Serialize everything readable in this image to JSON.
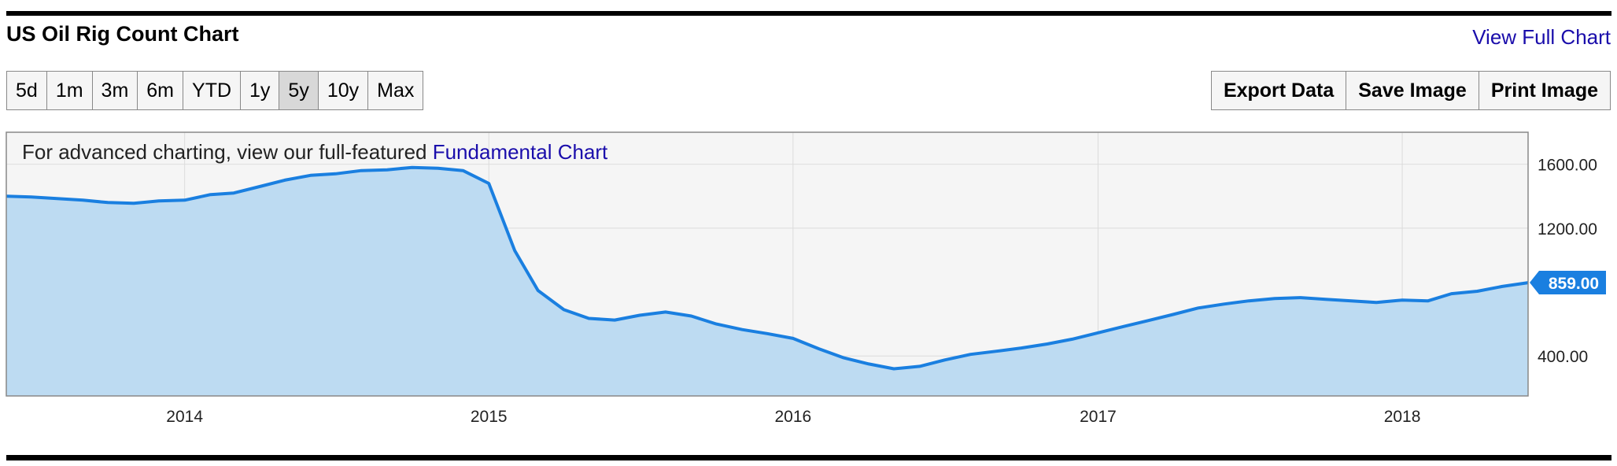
{
  "header": {
    "title": "US Oil Rig Count Chart",
    "view_full_link": "View Full Chart"
  },
  "range_buttons": [
    {
      "label": "5d",
      "active": false
    },
    {
      "label": "1m",
      "active": false
    },
    {
      "label": "3m",
      "active": false
    },
    {
      "label": "6m",
      "active": false
    },
    {
      "label": "YTD",
      "active": false
    },
    {
      "label": "1y",
      "active": false
    },
    {
      "label": "5y",
      "active": true
    },
    {
      "label": "10y",
      "active": false
    },
    {
      "label": "Max",
      "active": false
    }
  ],
  "actions": {
    "export": "Export Data",
    "save": "Save Image",
    "print": "Print Image"
  },
  "promo": {
    "text": "For advanced charting, view our full-featured ",
    "link": "Fundamental Chart"
  },
  "colors": {
    "line": "#1a7fe0",
    "fill": "#bddbf2",
    "plot_bg": "#f5f5f5",
    "grid": "#dcdcdc",
    "badge": "#1a7fe0"
  },
  "chart_data": {
    "type": "area",
    "title": "",
    "xlabel": "",
    "ylabel": "",
    "y_axis_side": "right",
    "grid": true,
    "xlim": [
      "2013-06-01",
      "2018-06-01"
    ],
    "ylim": [
      150,
      1800
    ],
    "y_ticks": [
      "400.00",
      "1200.00",
      "1600.00"
    ],
    "y_tick_values": [
      400,
      1200,
      1600
    ],
    "x_ticks": [
      "2014",
      "2015",
      "2016",
      "2017",
      "2018"
    ],
    "x_tick_dates": [
      "2014-01-01",
      "2015-01-01",
      "2016-01-01",
      "2017-01-01",
      "2018-01-01"
    ],
    "last_value_label": "859.00",
    "series": [
      {
        "x": [
          "2013-06-01",
          "2013-07-01",
          "2013-08-01",
          "2013-09-01",
          "2013-10-01",
          "2013-11-01",
          "2013-12-01",
          "2014-01-01",
          "2014-02-01",
          "2014-03-01",
          "2014-04-01",
          "2014-05-01",
          "2014-06-01",
          "2014-07-01",
          "2014-08-01",
          "2014-09-01",
          "2014-10-01",
          "2014-11-01",
          "2014-12-01",
          "2015-01-01",
          "2015-02-01",
          "2015-03-01",
          "2015-04-01",
          "2015-05-01",
          "2015-06-01",
          "2015-07-01",
          "2015-08-01",
          "2015-09-01",
          "2015-10-01",
          "2015-11-01",
          "2015-12-01",
          "2016-01-01",
          "2016-02-01",
          "2016-03-01",
          "2016-04-01",
          "2016-05-01",
          "2016-06-01",
          "2016-07-01",
          "2016-08-01",
          "2016-09-01",
          "2016-10-01",
          "2016-11-01",
          "2016-12-01",
          "2017-01-01",
          "2017-02-01",
          "2017-03-01",
          "2017-04-01",
          "2017-05-01",
          "2017-06-01",
          "2017-07-01",
          "2017-08-01",
          "2017-09-01",
          "2017-10-01",
          "2017-11-01",
          "2017-12-01",
          "2018-01-01",
          "2018-02-01",
          "2018-03-01",
          "2018-04-01",
          "2018-05-01",
          "2018-06-01"
        ],
        "values": [
          1400,
          1395,
          1385,
          1375,
          1360,
          1355,
          1370,
          1375,
          1410,
          1420,
          1460,
          1500,
          1530,
          1540,
          1560,
          1565,
          1580,
          1575,
          1560,
          1480,
          1060,
          810,
          690,
          635,
          625,
          655,
          675,
          650,
          600,
          565,
          540,
          510,
          445,
          390,
          350,
          320,
          335,
          375,
          410,
          430,
          450,
          475,
          505,
          545,
          585,
          620,
          660,
          700,
          725,
          745,
          760,
          765,
          755,
          745,
          735,
          750,
          745,
          790,
          805,
          835,
          859
        ]
      }
    ]
  }
}
